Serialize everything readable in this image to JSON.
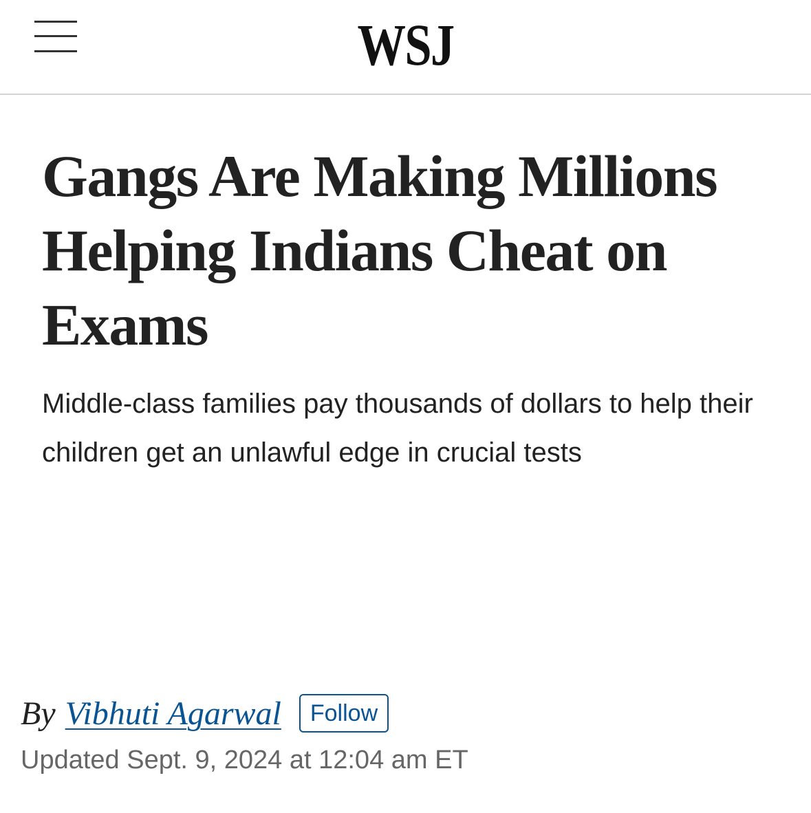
{
  "header": {
    "logo": "WSJ",
    "menu_icon": "hamburger-menu-icon"
  },
  "article": {
    "headline": "Gangs Are Making Millions Helping Indians Cheat on Exams",
    "dek": "Middle-class families pay thousands of dollars to help their children get an unlawful edge in crucial tests",
    "byline": {
      "prefix": "By",
      "author": "Vibhuti Agarwal",
      "follow_label": "Follow"
    },
    "timestamp": "Updated Sept. 9, 2024 at 12:04 am ET"
  },
  "colors": {
    "link": "#0a5493",
    "text": "#222222",
    "muted": "#666666"
  }
}
